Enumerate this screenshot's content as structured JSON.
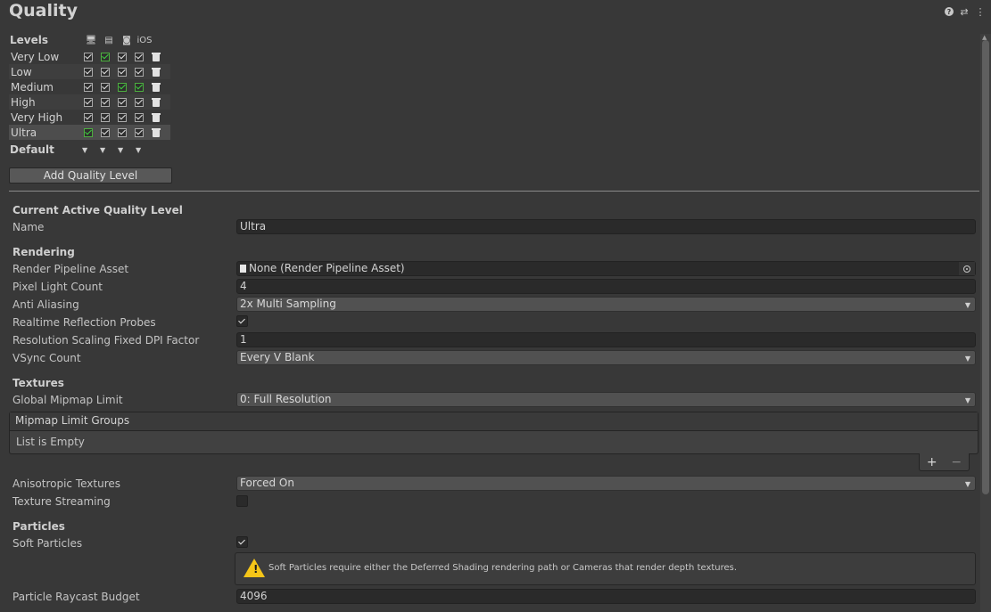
{
  "header": {
    "title": "Quality"
  },
  "header_icons": [
    "help-icon",
    "preset-icon",
    "more-menu-icon"
  ],
  "levels": {
    "label": "Levels",
    "platforms": [
      "standalone",
      "server",
      "android",
      "iOS"
    ],
    "rows": [
      {
        "name": "Very Low",
        "checks": [
          "on",
          "green",
          "on",
          "on"
        ]
      },
      {
        "name": "Low",
        "checks": [
          "on",
          "on",
          "on",
          "on"
        ]
      },
      {
        "name": "Medium",
        "checks": [
          "on",
          "on",
          "green",
          "green"
        ]
      },
      {
        "name": "High",
        "checks": [
          "on",
          "on",
          "on",
          "on"
        ]
      },
      {
        "name": "Very High",
        "checks": [
          "on",
          "on",
          "on",
          "on"
        ]
      },
      {
        "name": "Ultra",
        "checks": [
          "green",
          "on",
          "on",
          "on"
        ]
      }
    ],
    "selected": "Ultra",
    "default_label": "Default",
    "add_button": "Add Quality Level"
  },
  "current": {
    "heading": "Current Active Quality Level",
    "name_label": "Name",
    "name_value": "Ultra"
  },
  "rendering": {
    "heading": "Rendering",
    "pipeline_label": "Render Pipeline Asset",
    "pipeline_value": "None (Render Pipeline Asset)",
    "pixel_light_label": "Pixel Light Count",
    "pixel_light_value": "4",
    "aa_label": "Anti Aliasing",
    "aa_value": "2x Multi Sampling",
    "reflection_label": "Realtime Reflection Probes",
    "reflection_on": true,
    "dpi_label": "Resolution Scaling Fixed DPI Factor",
    "dpi_value": "1",
    "vsync_label": "VSync Count",
    "vsync_value": "Every V Blank"
  },
  "textures": {
    "heading": "Textures",
    "mipmap_label": "Global Mipmap Limit",
    "mipmap_value": "0: Full Resolution",
    "groups_title": "Mipmap Limit Groups",
    "groups_empty": "List is Empty",
    "add_symbol": "+",
    "remove_symbol": "−",
    "aniso_label": "Anisotropic Textures",
    "aniso_value": "Forced On",
    "streaming_label": "Texture Streaming",
    "streaming_on": false
  },
  "particles": {
    "heading": "Particles",
    "soft_label": "Soft Particles",
    "soft_on": true,
    "warning": "Soft Particles require either the Deferred Shading rendering path or Cameras that render depth textures.",
    "raycast_label": "Particle Raycast Budget",
    "raycast_value": "4096"
  },
  "colors": {
    "background": "#383838",
    "field": "#2a2a2a",
    "dropdown": "#515151",
    "green_check": "#3fd13f",
    "warning": "#f5c518"
  }
}
